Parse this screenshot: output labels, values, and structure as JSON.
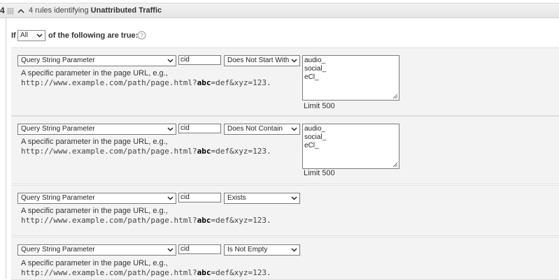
{
  "header": {
    "rule_number": "4",
    "title_prefix": "4 rules identifying ",
    "title_strong": "Unattributed Traffic"
  },
  "condition": {
    "if_label": "If",
    "match_value": "All",
    "tail_text": "of the following are true:"
  },
  "rules": [
    {
      "field": "Query String Parameter",
      "param": "cid",
      "operator": "Does Not Start With",
      "desc_line1": "A specific parameter in the page URL, e.g.,",
      "url_pre": "http://www.example.com/path/page.html?",
      "url_bold": "abc",
      "url_post": "=def&xyz=123.",
      "values": [
        "audio_",
        "social_",
        "eCl_"
      ],
      "limit": "Limit 500"
    },
    {
      "field": "Query String Parameter",
      "param": "cid",
      "operator": "Does Not Contain",
      "desc_line1": "A specific parameter in the page URL, e.g.,",
      "url_pre": "http://www.example.com/path/page.html?",
      "url_bold": "abc",
      "url_post": "=def&xyz=123.",
      "values": [
        "audio_",
        "social_",
        "eCl_"
      ],
      "limit": "Limit 500"
    },
    {
      "field": "Query String Parameter",
      "param": "cid",
      "operator": "Exists",
      "desc_line1": "A specific parameter in the page URL, e.g.,",
      "url_pre": "http://www.example.com/path/page.html?",
      "url_bold": "abc",
      "url_post": "=def&xyz=123."
    },
    {
      "field": "Query String Parameter",
      "param": "cid",
      "operator": "Is Not Empty",
      "desc_line1": "A specific parameter in the page URL, e.g.,",
      "url_pre": "http://www.example.com/path/page.html?",
      "url_bold": "abc",
      "url_post": "=def&xyz=123."
    }
  ],
  "icons": {
    "drag": "drag-handle-icon",
    "collapse": "chevron-up-icon",
    "help": "help-icon",
    "dropdown": "chevron-down-icon"
  }
}
